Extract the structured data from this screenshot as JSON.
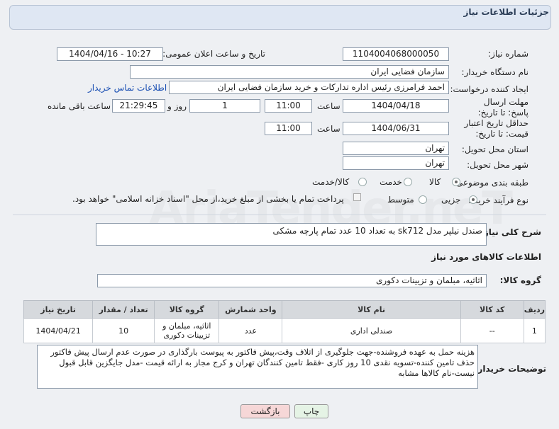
{
  "header": {
    "title": "جزئیات اطلاعات نیاز"
  },
  "labels": {
    "need_number": "شماره نیاز:",
    "announce_datetime": "تاریخ و ساعت اعلان عمومی:",
    "buyer_org": "نام دستگاه خریدار:",
    "creator": "ایجاد کننده درخواست:",
    "contact_link": "اطلاعات تماس خریدار",
    "deadline": "مهلت ارسال پاسخ: تا تاریخ:",
    "time": "ساعت",
    "days_and": "روز و",
    "hours_left": "ساعت باقی مانده",
    "price_validity": "حداقل تاریخ اعتبار قیمت: تا تاریخ:",
    "province": "استان محل تحویل:",
    "city": "شهر محل تحویل:",
    "category": "طبقه بندی موضوعی:",
    "process_type": "نوع فرآیند خرید :",
    "description": "شرح کلی نیاز:",
    "goods_info": "اطلاعات کالاهای مورد نیاز",
    "goods_group": "گروه کالا:",
    "buyer_notes": "توضیحات خریدار:"
  },
  "values": {
    "need_number": "1104004068000050",
    "announce_datetime": "1404/04/16 - 10:27",
    "buyer_org": "سازمان فضایی ایران",
    "creator": "احمد فرامرزی رئیس اداره تدارکات و خرید سازمان فضایی ایران",
    "deadline_date": "1404/04/18",
    "deadline_time": "11:00",
    "days": "1",
    "remaining_time": "21:29:45",
    "validity_date": "1404/06/31",
    "validity_time": "11:00",
    "province": "تهران",
    "city": "تهران",
    "description": "صندل نیلپر مدل sk712  به تعداد 10 عدد تمام پارچه مشکی",
    "goods_group": "اثاثیه، مبلمان و تزیینات دکوری",
    "buyer_notes": "هزینه حمل به عهده فروشنده-جهت جلوگیری از اتلاف وقت،پیش فاکتور به پیوست بارگذاری در صورت عدم ارسال پیش فاکتور حذف تامین کننده-تسویه نقدی 10 روز کاری -فقط تامین کنندگان تهران و کرج مجاز به ارائه قیمت -مدل جایگزین قابل قبول نیست-نام کالاها مشابه"
  },
  "category_options": [
    {
      "label": "کالا",
      "selected": true
    },
    {
      "label": "خدمت",
      "selected": false
    },
    {
      "label": "کالا/خدمت",
      "selected": false
    }
  ],
  "process_options": [
    {
      "label": "جزیی",
      "selected": true
    },
    {
      "label": "متوسط",
      "selected": false
    }
  ],
  "payment_note": "پرداخت تمام یا بخشی از مبلغ خرید،از محل \"اسناد خزانه اسلامی\" خواهد بود.",
  "table": {
    "headers": [
      "ردیف",
      "کد کالا",
      "نام کالا",
      "واحد شمارش",
      "گروه کالا",
      "تعداد / مقدار",
      "تاریخ نیاز"
    ],
    "rows": [
      [
        "1",
        "--",
        "صندلی اداری",
        "عدد",
        "اثاثیه، مبلمان و تزیینات دکوری",
        "10",
        "1404/04/21"
      ]
    ]
  },
  "buttons": {
    "print": "چاپ",
    "back": "بازگشت"
  },
  "watermark": "AriaTender.neT",
  "colors": {
    "link": "#1a4fb3",
    "header_bg": "#dfe7f3",
    "back_button": "#f6d7d7",
    "print_button": "#e5f3e5"
  }
}
